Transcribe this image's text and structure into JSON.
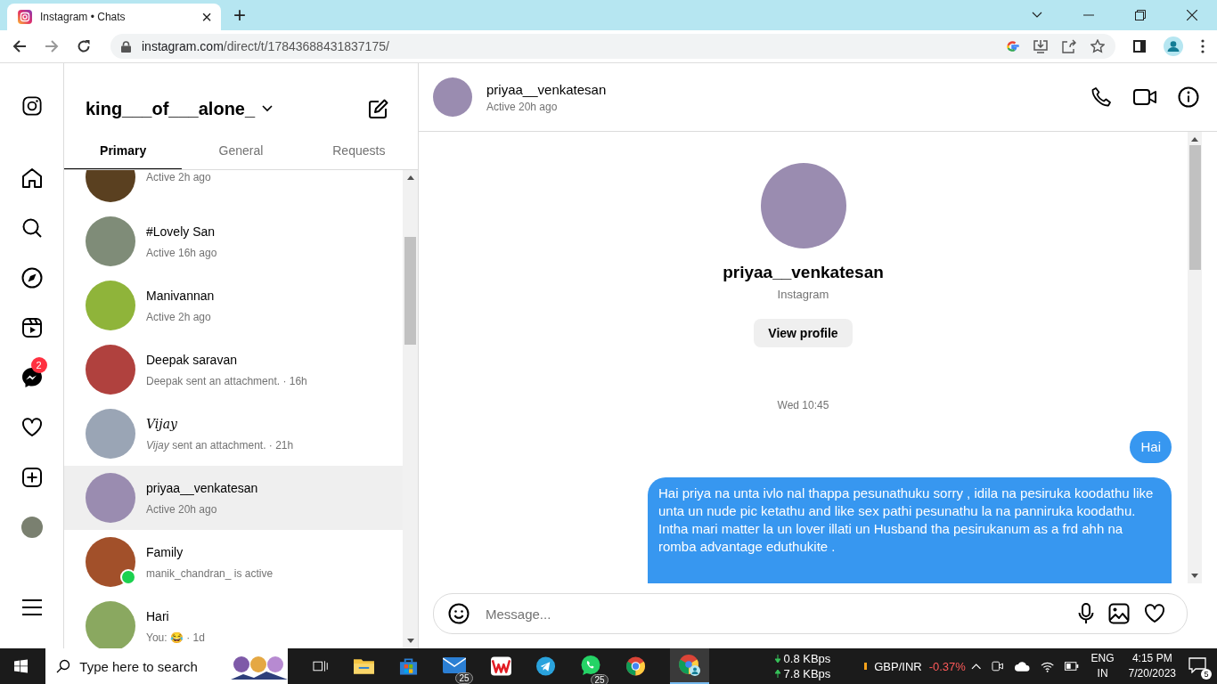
{
  "browser": {
    "tab_title": "Instagram • Chats",
    "tab_close": "×",
    "new_tab": "+",
    "url_host": "instagram.com",
    "url_path": "/direct/t/17843688431837175/"
  },
  "nav": {
    "notification_badge": "2"
  },
  "inbox": {
    "username": "king___of___alone_",
    "tabs": [
      {
        "label": "Primary",
        "selected": true
      },
      {
        "label": "General",
        "selected": false
      },
      {
        "label": "Requests",
        "selected": false
      }
    ],
    "chats": [
      {
        "subtitle": "Active 2h ago",
        "kind": "plain",
        "selected": false,
        "online": false,
        "color": "#5a4020"
      },
      {
        "name": "#Lovely San",
        "subtitle": "Active 16h ago",
        "kind": "plain",
        "selected": false,
        "online": false,
        "color": "#7f8c78"
      },
      {
        "name": "Manivannan",
        "subtitle": "Active 2h ago",
        "kind": "plain",
        "selected": false,
        "online": false,
        "color": "#8fb43a"
      },
      {
        "name": "Deepak saravan",
        "subtitle": "Deepak sent an attachment. · 16h",
        "kind": "plain",
        "selected": false,
        "online": false,
        "color": "#b0413e"
      },
      {
        "name": "Vijay",
        "subtitle": "*Vijay* sent an attachment. · 21h",
        "kind": "script",
        "selected": false,
        "online": false,
        "color": "#9aa5b5"
      },
      {
        "name": "priyaa__venkatesan",
        "subtitle": "Active 20h ago",
        "kind": "plain",
        "selected": true,
        "online": false,
        "color": "#9a8cb0"
      },
      {
        "name": "Family",
        "subtitle": "manik_chandran_ is active",
        "kind": "plain",
        "selected": false,
        "online": true,
        "color": "#a2502a"
      },
      {
        "name": "Hari",
        "subtitle": "You: 😂 · 1d",
        "kind": "plain",
        "selected": false,
        "online": false,
        "color": "#8aa860"
      }
    ]
  },
  "conversation": {
    "name": "priyaa__venkatesan",
    "status": "Active 20h ago",
    "profile_name": "priyaa__venkatesan",
    "profile_source": "Instagram",
    "view_profile": "View profile",
    "date": "Wed 10:45",
    "messages": [
      {
        "text": "Hai",
        "sent": true
      },
      {
        "text": "Hai priya na unta ivlo nal thappa pesunathuku sorry , idila na pesiruka koodathu like unta un nude pic ketathu and like sex pathi pesunathu la na panniruka koodathu. Intha mari matter la un lover illati un Husband tha pesirukanum as a frd ahh na romba advantage eduthukite .",
        "sent": true
      }
    ],
    "composer_placeholder": "Message..."
  },
  "taskbar": {
    "search_placeholder": "Type here to search",
    "mail_badge": "25",
    "whatsapp_badge": "25",
    "net_down": "0.8 KBps",
    "net_up": "7.8 KBps",
    "ticker_name": "GBP/INR",
    "ticker_change": "-0.37%",
    "lang": "ENG",
    "region": "IN",
    "time": "4:15 PM",
    "date": "7/20/2023",
    "notif_count": "5"
  }
}
